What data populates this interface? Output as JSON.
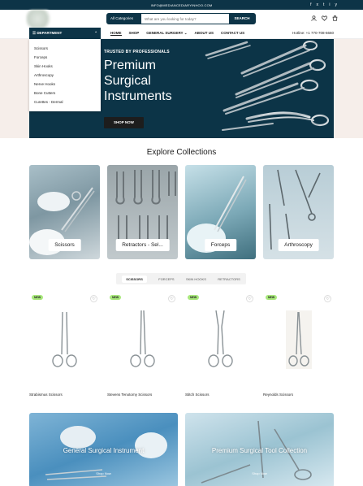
{
  "topbar": {
    "email": "INFO@MEDIANCEDIARYINHOO.COM",
    "social": [
      "f",
      "x",
      "t",
      "i",
      "y"
    ]
  },
  "header": {
    "category_select": "All Categories",
    "search_placeholder": "What are you looking for today?",
    "search_button": "SEARCH",
    "icons": [
      "user-icon",
      "heart-icon",
      "cart-icon"
    ]
  },
  "nav": {
    "department": "DEPARTMENT",
    "menu": [
      "HOME",
      "SHOP",
      "GENERAL SURGERY",
      "ABOUT US",
      "CONTACT US"
    ],
    "phone": "Hotline: +1 770-708-6660"
  },
  "departments": [
    "Scissors",
    "Forceps",
    "Skin Hooks",
    "Arthroscopy",
    "Nerve Hooks",
    "Bone Cutters",
    "Curettes - Dermal"
  ],
  "hero": {
    "tagline": "TRUSTED BY PROFESSIONALS",
    "title": "Premium Surgical Instruments",
    "button": "SHOP NOW"
  },
  "collections": {
    "title": "Explore Collections",
    "items": [
      "Scissors",
      "Retractors - Sel...",
      "Forceps",
      "Arthroscopy"
    ]
  },
  "tabs": [
    "SCISSORS",
    "FORCEPS",
    "SKIN HOOKS",
    "RETRACTORS"
  ],
  "products": [
    {
      "name": "Strabismus Scissors",
      "badge": "NEW"
    },
    {
      "name": "Stevens Tenotomy Scissors",
      "badge": "NEW"
    },
    {
      "name": "Stitch Scissors",
      "badge": "NEW"
    },
    {
      "name": "Reynolds Scissors",
      "badge": "NEW"
    }
  ],
  "banners": [
    {
      "title": "General Surgical Instrument",
      "button": "Shop Now"
    },
    {
      "title": "Premium Surgical Tool Collection",
      "button": "Shop Now"
    }
  ],
  "colors": {
    "navy": "#0d3447",
    "badge_green": "#a9e87d",
    "hero_side": "#f6eeea"
  }
}
